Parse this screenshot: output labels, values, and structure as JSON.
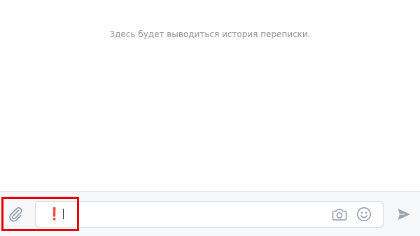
{
  "history": {
    "empty_text": "Здесь будет выводиться история переписки."
  },
  "composer": {
    "message_emoji": "❗",
    "message_text": "",
    "icons": {
      "attach": "paperclip-icon",
      "camera": "camera-icon",
      "emoji": "smile-icon",
      "send": "send-icon"
    }
  },
  "colors": {
    "icon_gray": "#8d99a6",
    "empty_text": "#8a929c",
    "highlight": "#e60000",
    "exclamation": "#e0311b"
  }
}
